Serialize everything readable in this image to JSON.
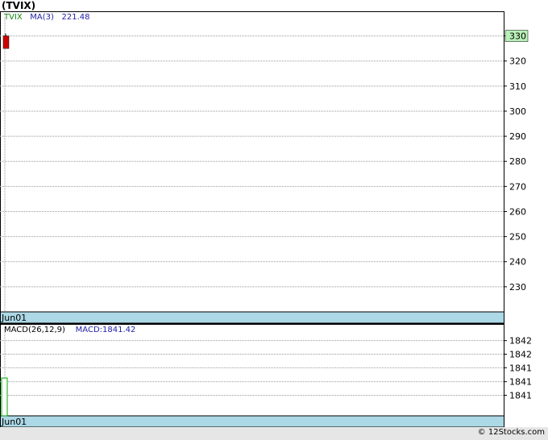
{
  "ticker_title": "(TVIX)",
  "watermark": "© 12Stocks.com",
  "price_legend": {
    "symbol": "TVIX",
    "ma_label": "MA(3)",
    "ma_value": "221.48"
  },
  "macd_legend": {
    "label": "MACD(26,12,9)",
    "value_label": "MACD:1841.42"
  },
  "colors": {
    "up": "#00aa00",
    "down": "#cc0000",
    "ma": "#2222aa",
    "date_band": "#add8e6",
    "current_price_bg": "#b8f0b8"
  },
  "chart_data": [
    {
      "type": "candlestick",
      "title": "(TVIX)",
      "x": [
        "Jun01"
      ],
      "ylim": [
        220,
        335
      ],
      "yticks": [
        230,
        240,
        250,
        260,
        270,
        280,
        290,
        300,
        310,
        320,
        330
      ],
      "ytick_labels": [
        "230",
        "240",
        "250",
        "260",
        "270",
        "280",
        "290",
        "300",
        "310",
        "320",
        "330"
      ],
      "current_price_label": "330",
      "candles": [
        {
          "date": "Jun01",
          "open": 330,
          "high": 331,
          "low": 325,
          "close": 325
        }
      ],
      "grid": true
    },
    {
      "type": "bar",
      "title": "MACD(26,12,9)",
      "x": [
        "Jun01"
      ],
      "ylim": [
        1840.5,
        1842.5
      ],
      "yticks": [
        1841,
        1841.33,
        1841.67,
        1842,
        1842.33
      ],
      "ytick_labels": [
        "1841",
        "1841",
        "1841",
        "1842",
        "1842"
      ],
      "values": [
        1841.42
      ],
      "grid": true
    }
  ]
}
